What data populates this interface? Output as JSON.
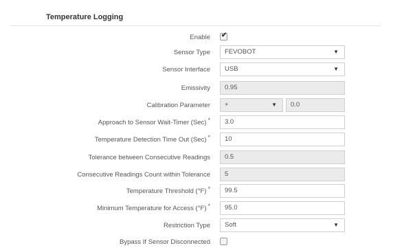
{
  "section": {
    "title": "Temperature Logging"
  },
  "fields": {
    "enable": {
      "label": "Enable",
      "checked": true,
      "mark": "✔"
    },
    "sensor_type": {
      "label": "Sensor Type",
      "value": "FEVOBOT"
    },
    "sensor_interface": {
      "label": "Sensor Interface",
      "value": "USB"
    },
    "emissivity": {
      "label": "Emissivity",
      "value": "0.95"
    },
    "calibration": {
      "label": "Calibration Parameter",
      "operator": "+",
      "value": "0.0"
    },
    "approach_timer": {
      "label": "Approach to Sensor Wait-Timer (Sec)",
      "value": "3.0",
      "required": "*"
    },
    "detection_timeout": {
      "label": "Temperature Detection Time Out (Sec)",
      "value": "10",
      "required": "*"
    },
    "tolerance": {
      "label": "Tolerance between Consecutive Readings",
      "value": "0.5"
    },
    "readings_count": {
      "label": "Consecutive Readings Count within Tolerance",
      "value": "5"
    },
    "threshold": {
      "label": "Temperature Threshold (°F)",
      "value": "99.5",
      "required": "*"
    },
    "min_temp": {
      "label": "Minimum Temperature for Access (°F)",
      "value": "95.0",
      "required": "*"
    },
    "restriction_type": {
      "label": "Restriction Type",
      "value": "Soft"
    },
    "bypass": {
      "label": "Bypass If Sensor Disconnected",
      "checked": false
    }
  },
  "icons": {
    "dropdown": "▼"
  }
}
